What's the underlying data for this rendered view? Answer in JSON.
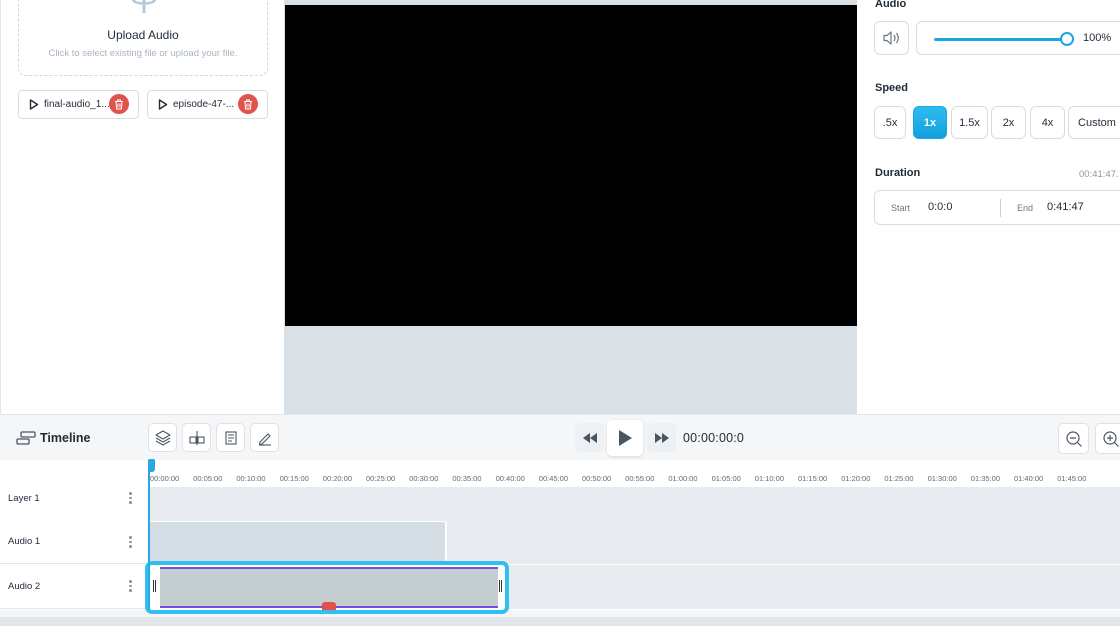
{
  "upload": {
    "title": "Upload Audio",
    "subtitle": "Click to select existing file or upload your file."
  },
  "files": [
    {
      "name": "final-audio_1..."
    },
    {
      "name": "episode-47-..."
    }
  ],
  "audio": {
    "label": "Audio",
    "volume_value": "100%",
    "volume_level": 1.0
  },
  "speed": {
    "label": "Speed",
    "options": [
      ".5x",
      "1x",
      "1.5x",
      "2x",
      "4x",
      "Custom"
    ],
    "selected": "1x"
  },
  "duration": {
    "label": "Duration",
    "total": "00:41:47.",
    "start_label": "Start",
    "start_value": "0:0:0",
    "end_label": "End",
    "end_value": "0:41:47"
  },
  "timeline": {
    "title": "Timeline",
    "time": "00:00:00:0",
    "ruler_ticks": [
      "00:00:00",
      "00:05:00",
      "00:10:00",
      "00:15:00",
      "00:20:00",
      "00:25:00",
      "00:30:00",
      "00:35:00",
      "00:40:00",
      "00:45:00",
      "00:50:00",
      "00:55:00",
      "01:00:00",
      "01:05:00",
      "01:10:00",
      "01:15:00",
      "01:20:00",
      "01:25:00",
      "01:30:00",
      "01:35:00",
      "01:40:00",
      "01:45:00"
    ],
    "tracks": [
      {
        "name": "Layer 1"
      },
      {
        "name": "Audio 1"
      },
      {
        "name": "Audio 2"
      }
    ]
  },
  "colors": {
    "accent": "#1aa6e0",
    "delete": "#e0524a",
    "selection": "#31bff0"
  }
}
